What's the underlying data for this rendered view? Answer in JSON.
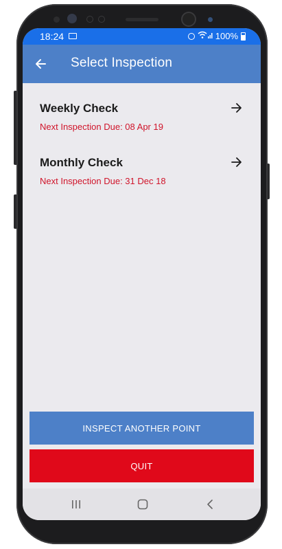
{
  "status_bar": {
    "time": "18:24",
    "battery": "100%",
    "color": "#1a6fe8"
  },
  "app_bar": {
    "title": "Select Inspection",
    "back_icon": "back-arrow-icon",
    "color": "#4d80c8"
  },
  "inspections": [
    {
      "title": "Weekly Check",
      "due": "Next Inspection Due: 08 Apr 19"
    },
    {
      "title": "Monthly Check",
      "due": "Next Inspection Due: 31 Dec 18"
    }
  ],
  "buttons": {
    "inspect_another": "INSPECT ANOTHER POINT",
    "quit": "QUIT"
  },
  "colors": {
    "due_text": "#d0142a",
    "quit": "#e0091a",
    "background": "#ebeaee"
  },
  "nav_bar": {
    "icons": [
      "recents-icon",
      "home-icon",
      "back-icon"
    ]
  }
}
